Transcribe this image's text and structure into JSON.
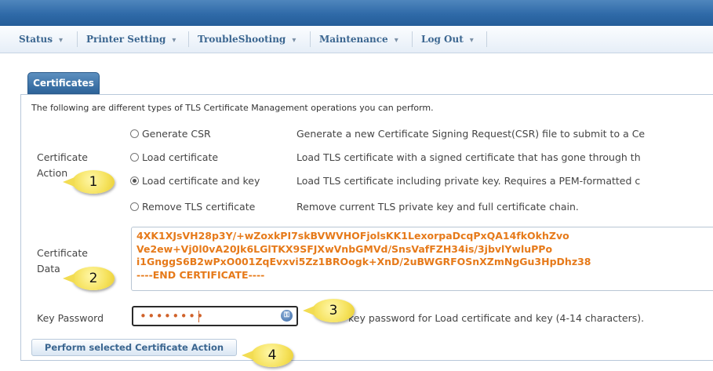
{
  "nav": {
    "items": [
      {
        "label": "Status",
        "caret": "▾"
      },
      {
        "label": "Printer Setting",
        "caret": "▾"
      },
      {
        "label": "TroubleShooting",
        "caret": "▾"
      },
      {
        "label": "Maintenance",
        "caret": "▾"
      },
      {
        "label": "Log Out",
        "caret": "▾"
      }
    ]
  },
  "section": {
    "tab_label": "Certificates",
    "intro": "The following are different types of TLS Certificate Management operations you can perform."
  },
  "certificate_action": {
    "label_line1": "Certificate",
    "label_line2": "Action",
    "selected": "Load certificate and key",
    "options": [
      {
        "label": "Generate CSR",
        "description": "Generate a new Certificate Signing Request(CSR) file to submit to a Ce",
        "checked": false
      },
      {
        "label": "Load certificate",
        "description": "Load TLS certificate with a signed certificate that has gone through th",
        "checked": false
      },
      {
        "label": "Load certificate and key",
        "description": "Load TLS certificate including private key. Requires a PEM-formatted c",
        "checked": true
      },
      {
        "label": "Remove TLS certificate",
        "description": "Remove current TLS private key and full certificate chain.",
        "checked": false
      }
    ]
  },
  "certificate_data": {
    "label_line1": "Certificate",
    "label_line2": "Data",
    "lines": [
      "4XK1XJsVH28p3Y/+wZoxkPI7skBVWVHOFjolsKK1LexorpaDcqPxQA14fkOkhZvo",
      "Ve2ew+Vj0l0vA20Jk6LGlTKX9SFJXwVnbGMVd/SnsVafFZH34is/3jbvlYwluPPo",
      "i1GnggS6B2wPxO001ZqEvxvi5Zz1BROogk+XnD/2uBWGRFOSnXZmNgGu3HpDhz38",
      "----END CERTIFICATE----"
    ]
  },
  "key_password": {
    "label": "Key Password",
    "masked_value": "••••••••",
    "hint": "key password for Load certificate and key (4-14 characters)."
  },
  "perform_button": {
    "label": "Perform selected Certificate Action"
  },
  "callouts": [
    "1",
    "2",
    "3",
    "4"
  ],
  "colors": {
    "header_blue": "#2f6aa8",
    "nav_text": "#3b6690",
    "certificate_text_orange": "#e67a1a",
    "callout_yellow": "#f5e15a"
  }
}
